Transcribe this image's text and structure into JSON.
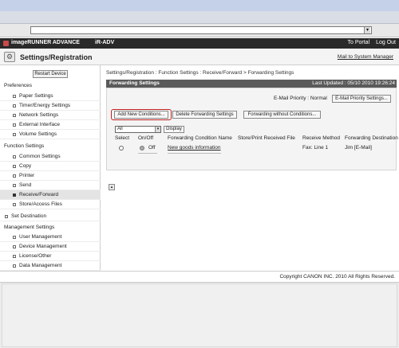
{
  "header": {
    "brand": "imageRUNNER ADVANCE",
    "model": "iR-ADV",
    "to_portal": "To Portal",
    "log_out": "Log Out"
  },
  "title_bar": {
    "title": "Settings/Registration",
    "mail_link": "Mail to System Manager"
  },
  "sidebar": {
    "restart_label": "Restart Device",
    "preferences_title": "Preferences",
    "preferences": [
      "Paper Settings",
      "Timer/Energy Settings",
      "Network Settings",
      "External Interface",
      "Volume Settings"
    ],
    "function_title": "Function Settings",
    "function_items": [
      "Common Settings",
      "Copy",
      "Printer",
      "Send",
      "Receive/Forward",
      "Store/Access Files"
    ],
    "set_destination": "Set Destination",
    "management_title": "Management Settings",
    "management_items": [
      "User Management",
      "Device Management",
      "License/Other",
      "Data Management"
    ]
  },
  "main": {
    "breadcrumb": "Settings/Registration : Function Settings : Receive/Forward > Forwarding Settings",
    "panel_title": "Forwarding Settings",
    "last_updated": "Last Updated : 05/10 2010 19:26:24",
    "email_priority_label": "E-Mail Priority : Normal",
    "email_priority_button": "E-Mail Priority Settings...",
    "add_button": "Add New Conditions...",
    "delete_button": "Delete Forwarding Settings",
    "without_button": "Forwarding without Conditions...",
    "filter_value": "All",
    "display_button": "Display",
    "columns": [
      "Select",
      "On/Off",
      "Forwarding Condition Name",
      "Store/Print Received File",
      "Receive Method",
      "Forwarding Destination"
    ],
    "row": {
      "onoff": "Off",
      "name": "New goods information",
      "store_print": "",
      "method": "Fax: Line 1",
      "destination": "Jim [E-Mail]"
    }
  },
  "footer": {
    "copyright": "Copyright CANON INC. 2010 All Rights Reserved."
  }
}
